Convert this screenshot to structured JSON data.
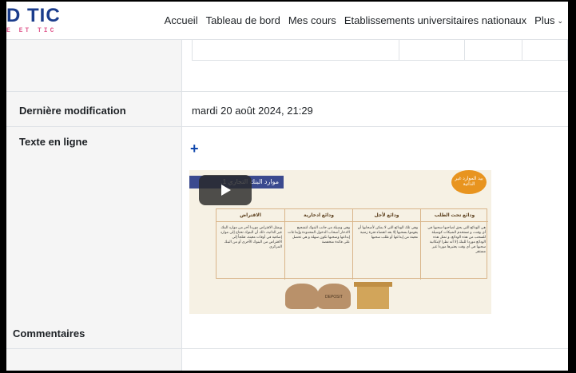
{
  "brand": {
    "logo_main": "D TIC",
    "logo_sub": "E ET TIC"
  },
  "nav": {
    "items": [
      {
        "label": "Accueil"
      },
      {
        "label": "Tableau de bord"
      },
      {
        "label": "Mes cours"
      },
      {
        "label": "Etablissements universitaires nationaux"
      },
      {
        "label": "Plus"
      }
    ],
    "more_icon": "chevron-down-icon"
  },
  "rows": {
    "last_modified": {
      "label": "Dernière modification",
      "value": "mardi 20 août 2024, 21:29"
    },
    "online_text": {
      "label": "Texte en ligne",
      "expand_icon": "plus-icon"
    },
    "comments": {
      "label": "Commentaires"
    }
  },
  "slide": {
    "title": ".1 موارد البنك التجاري",
    "badge": "بيد الموارد غير الذاتية",
    "play_icon": "play-icon",
    "columns": [
      {
        "head": "ودائع تحت الطلب",
        "text": "هي الودائع التي يحق لصاحبها سحبها في أي وقت، و تستخدم الشيكات كوسيلة للسحب من هذه الودائع، و تمثل هذه الودائع موردا للبنك إلا أنه نظرا لإمكانية سحبها في أي وقت يعتبرها موردا غير مستقر"
      },
      {
        "head": "ودائع لأجل",
        "text": "وهي تلك الودائع التي لا يمكن لأصحابها أن يقوموا بسحبها إلا بعد انقضاء فترة زمنية معينة من إيداعها أو طلب سحبها"
      },
      {
        "head": "ودائع ادخارية",
        "text": "وهي وسيلة من جانب البنوك لتشجيع الادخار أصحاب الدخول المحدودة وإيداعات إيداعها وسحبها تكون سهلة و هي تحصل على فائدة منخفضة"
      },
      {
        "head": "الاقتراض",
        "text": "ويمثل الاقتراض موردا آخر من موارد البنك غير الذاتية، ذلك أن البنوك تحتاج إلى موارد إضافية في أوقات معينة، فتلجأ إلى الاقتراض من البنوك الأخرى أو من البنك المركزي"
      }
    ],
    "image_label": "DEPOSIT"
  },
  "colors": {
    "brand_blue": "#1a3c8c",
    "brand_pink": "#e05a8e",
    "accent_blue": "#0f47ad",
    "slide_header": "#3b4a8f",
    "badge_orange": "#e8941f"
  }
}
